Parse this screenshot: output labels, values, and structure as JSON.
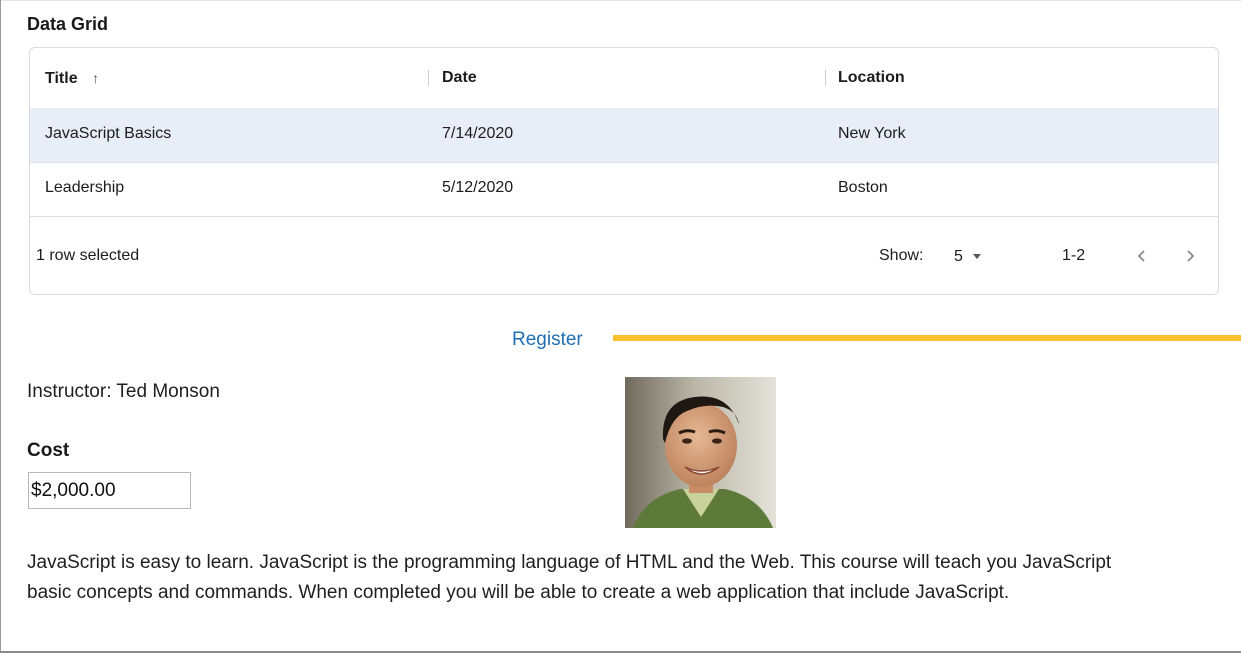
{
  "section_title": "Data Grid",
  "grid": {
    "columns": [
      {
        "label": "Title",
        "sorted": "ascending"
      },
      {
        "label": "Date"
      },
      {
        "label": "Location"
      }
    ],
    "rows": [
      {
        "title": "JavaScript Basics",
        "date": "7/14/2020",
        "location": "New York",
        "selected": true
      },
      {
        "title": "Leadership",
        "date": "5/12/2020",
        "location": "Boston",
        "selected": false
      }
    ],
    "footer": {
      "selection_text": "1 row selected",
      "show_label": "Show:",
      "page_size": "5",
      "range": "1-2"
    }
  },
  "register_link": "Register",
  "instructor": "Instructor: Ted Monson",
  "cost": {
    "label": "Cost",
    "value": "$2,000.00"
  },
  "description": "JavaScript is easy to learn. JavaScript is the programming language of HTML and the Web.  This course will teach you JavaScript  basic concepts and commands.  When completed you will be able to create a web application that include JavaScript.",
  "colors": {
    "selected_row": "#e8eef7",
    "link": "#1f6fb2",
    "accent": "#fbc02d"
  },
  "icons": {
    "sort": "arrow-up-icon",
    "dropdown": "caret-down-icon",
    "previous": "chevron-left-icon",
    "next": "chevron-right-icon"
  }
}
